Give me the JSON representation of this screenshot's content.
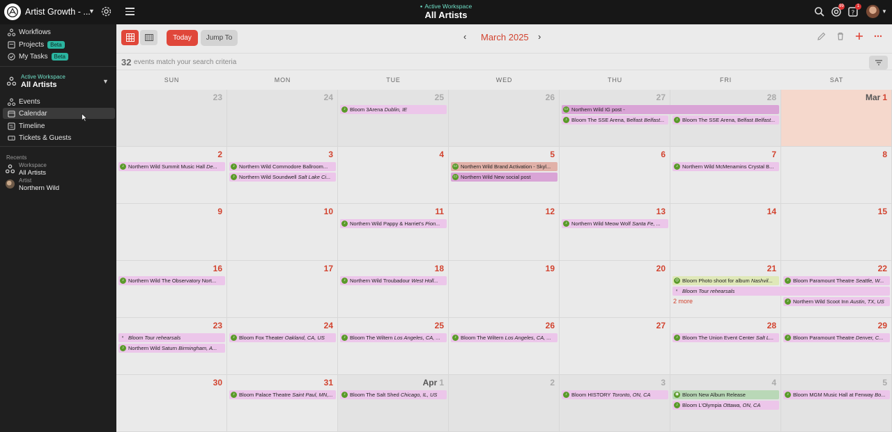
{
  "topbar": {
    "org_name": "Artist Growth - ...",
    "workspace_label": "Active Workspace",
    "workspace_name": "All Artists",
    "notif_badge_1": "99",
    "notif_badge_2": "1"
  },
  "sidebar": {
    "items": [
      {
        "label": "Workflows",
        "icon": "workflow-icon"
      },
      {
        "label": "Projects",
        "badge": "Beta",
        "icon": "projects-icon"
      },
      {
        "label": "My Tasks",
        "badge": "Beta",
        "icon": "tasks-icon"
      }
    ],
    "workspace_label": "Active Workspace",
    "workspace_name": "All Artists",
    "nav": [
      {
        "label": "Events",
        "icon": "events-icon"
      },
      {
        "label": "Calendar",
        "icon": "calendar-icon"
      },
      {
        "label": "Timeline",
        "icon": "timeline-icon"
      },
      {
        "label": "Tickets & Guests",
        "icon": "ticket-icon"
      }
    ],
    "recents_heading": "Recents",
    "recents": [
      {
        "kind": "Workspace",
        "name": "All Artists"
      },
      {
        "kind": "Artist",
        "name": "Northern Wild"
      }
    ]
  },
  "toolbar": {
    "today": "Today",
    "jump_to": "Jump To",
    "month": "March 2025",
    "prev": "‹",
    "next": "›"
  },
  "search": {
    "count": "32",
    "text": "events match your search criteria"
  },
  "weekdays": [
    "SUN",
    "MON",
    "TUE",
    "WED",
    "THU",
    "FRI",
    "SAT"
  ],
  "weeks": [
    [
      {
        "day": "23",
        "other": true
      },
      {
        "day": "24",
        "other": true
      },
      {
        "day": "25",
        "other": true,
        "events": [
          {
            "artist": "Bloom",
            "title": "3Arena",
            "loc": "Dublin, IE",
            "color": "pink"
          }
        ]
      },
      {
        "day": "26",
        "other": true
      },
      {
        "day": "27",
        "other": true,
        "events": [
          {
            "artist": "Northern Wild",
            "title": "IG post -",
            "loc": "",
            "color": "purple",
            "icon": "post",
            "span": 2
          },
          {
            "artist": "Bloom",
            "title": "The SSE Arena, Belfast",
            "loc": "Belfast...",
            "color": "pink"
          }
        ]
      },
      {
        "day": "28",
        "other": true,
        "events": [
          {
            "slot": true
          },
          {
            "artist": "Bloom",
            "title": "The SSE Arena, Belfast",
            "loc": "Belfast...",
            "color": "pink"
          }
        ]
      },
      {
        "day": "1",
        "month": "Mar",
        "today": true
      }
    ],
    [
      {
        "day": "2",
        "events": [
          {
            "artist": "Northern Wild",
            "title": "Summit Music Hall",
            "loc": "De...",
            "color": "pink"
          }
        ]
      },
      {
        "day": "3",
        "events": [
          {
            "artist": "Northern Wild",
            "title": "Commodore Ballroom...",
            "loc": "",
            "color": "pink"
          },
          {
            "artist": "Northern Wild",
            "title": "Soundwell",
            "loc": "Salt Lake Ci...",
            "color": "pink"
          }
        ]
      },
      {
        "day": "4"
      },
      {
        "day": "5",
        "events": [
          {
            "artist": "Northern Wild",
            "title": "Brand Activation - Skyl...",
            "loc": "",
            "color": "peach",
            "icon": "post"
          },
          {
            "artist": "Northern Wild",
            "title": "New social post",
            "loc": "",
            "color": "purple",
            "icon": "post"
          }
        ]
      },
      {
        "day": "6"
      },
      {
        "day": "7",
        "events": [
          {
            "artist": "Northern Wild",
            "title": "McMenamins Crystal B...",
            "loc": "",
            "color": "pink"
          }
        ]
      },
      {
        "day": "8"
      }
    ],
    [
      {
        "day": "9"
      },
      {
        "day": "10"
      },
      {
        "day": "11",
        "events": [
          {
            "artist": "Northern Wild",
            "title": "Pappy & Harriet's",
            "loc": "Pion...",
            "color": "pink"
          }
        ]
      },
      {
        "day": "12"
      },
      {
        "day": "13",
        "events": [
          {
            "artist": "Northern Wild",
            "title": "Meow Wolf",
            "loc": "Santa Fe, ...",
            "color": "pink"
          }
        ]
      },
      {
        "day": "14"
      },
      {
        "day": "15"
      }
    ],
    [
      {
        "day": "16",
        "events": [
          {
            "artist": "Northern Wild",
            "title": "The Observatory Nort...",
            "loc": "",
            "color": "pink"
          }
        ]
      },
      {
        "day": "17"
      },
      {
        "day": "18",
        "events": [
          {
            "artist": "Northern Wild",
            "title": "Troubadour",
            "loc": "West Holl...",
            "color": "pink"
          }
        ]
      },
      {
        "day": "19"
      },
      {
        "day": "20"
      },
      {
        "day": "21",
        "events": [
          {
            "artist": "Bloom",
            "title": "Photo shoot for album",
            "loc": "Nashvil...",
            "color": "lime",
            "icon": "photo"
          },
          {
            "artist": "Bloom",
            "title": "Tour rehearsals",
            "loc": "",
            "color": "pink",
            "icon": "rehearsal",
            "italic": true,
            "span": 2
          }
        ],
        "more": "2 more"
      },
      {
        "day": "22",
        "events": [
          {
            "artist": "Bloom",
            "title": "Paramount Theatre",
            "loc": "Seattle, W...",
            "color": "pink"
          },
          {
            "slot": true
          },
          {
            "artist": "Northern Wild",
            "title": "Scoot Inn",
            "loc": "Austin, TX, US",
            "color": "pink"
          }
        ]
      }
    ],
    [
      {
        "day": "23",
        "events": [
          {
            "artist": "Bloom",
            "title": "Tour rehearsals",
            "loc": "",
            "color": "pink",
            "icon": "rehearsal",
            "italic": true
          },
          {
            "artist": "Northern Wild",
            "title": "Saturn",
            "loc": "Birmingham, A...",
            "color": "pink"
          }
        ]
      },
      {
        "day": "24",
        "events": [
          {
            "artist": "Bloom",
            "title": "Fox Theater",
            "loc": "Oakland, CA, US",
            "color": "pink"
          }
        ]
      },
      {
        "day": "25",
        "events": [
          {
            "artist": "Bloom",
            "title": "The Wiltern",
            "loc": "Los Angeles, CA, ...",
            "color": "pink"
          }
        ]
      },
      {
        "day": "26",
        "events": [
          {
            "artist": "Bloom",
            "title": "The Wiltern",
            "loc": "Los Angeles, CA, ...",
            "color": "pink"
          }
        ]
      },
      {
        "day": "27"
      },
      {
        "day": "28",
        "events": [
          {
            "artist": "Bloom",
            "title": "The Union Event Center",
            "loc": "Salt L...",
            "color": "pink"
          }
        ]
      },
      {
        "day": "29",
        "events": [
          {
            "artist": "Bloom",
            "title": "Paramount Theatre",
            "loc": "Denver, C...",
            "color": "pink"
          }
        ]
      }
    ],
    [
      {
        "day": "30"
      },
      {
        "day": "31",
        "events": [
          {
            "artist": "Bloom",
            "title": "Palace Theatre",
            "loc": "Saint Paul, MN,...",
            "color": "pink"
          }
        ]
      },
      {
        "day": "1",
        "month": "Apr",
        "other": true,
        "events": [
          {
            "artist": "Bloom",
            "title": "The Salt Shed",
            "loc": "Chicago, IL, US",
            "color": "pink"
          }
        ]
      },
      {
        "day": "2",
        "other": true
      },
      {
        "day": "3",
        "other": true,
        "events": [
          {
            "artist": "Bloom",
            "title": "HISTORY",
            "loc": "Toronto, ON, CA",
            "color": "pink"
          }
        ]
      },
      {
        "day": "4",
        "other": true,
        "events": [
          {
            "artist": "Bloom",
            "title": "New Album Release",
            "loc": "",
            "color": "green",
            "icon": "release"
          },
          {
            "artist": "Bloom",
            "title": "L'Olympia",
            "loc": "Ottawa, ON, CA",
            "color": "pink"
          }
        ]
      },
      {
        "day": "5",
        "other": true,
        "events": [
          {
            "artist": "Bloom",
            "title": "MGM Music Hall at Fenway",
            "loc": "Bo...",
            "color": "pink"
          }
        ]
      }
    ]
  ],
  "colors": {
    "accent": "#e0473a",
    "day_number": "#d2432f",
    "event_pink": "#ecc6ea",
    "event_purple": "#d9a4d6",
    "event_peach": "#e1b1a8",
    "event_green": "#b9d8b7",
    "event_lime": "#dfe8b8",
    "today_bg": "#f5d8cc",
    "workspace_teal": "#6fe0c8"
  }
}
